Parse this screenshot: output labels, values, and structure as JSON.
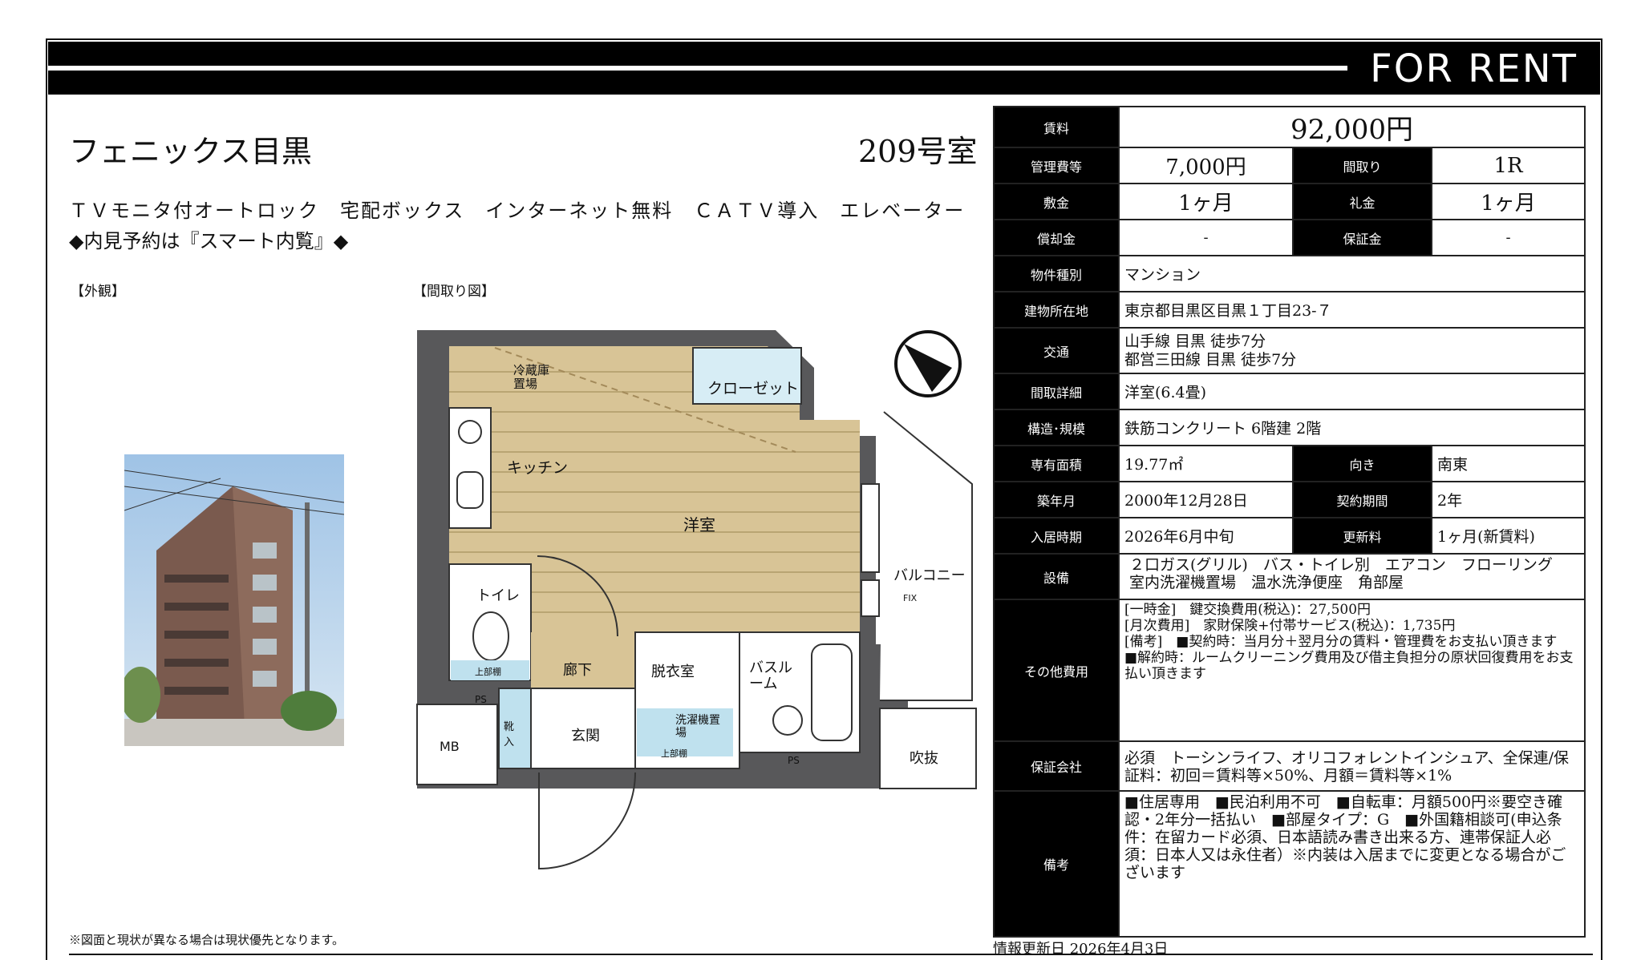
{
  "banner": {
    "title": "FOR RENT"
  },
  "property": {
    "name": "フェニックス目黒",
    "room": "209号室",
    "features": "ＴＶモニタ付オートロック　宅配ボックス　インターネット無料　ＣＡＴＶ導入　エレベーター",
    "viewing": "◆内見予約は『スマート内覧』◆"
  },
  "labels": {
    "exterior": "【外観】",
    "floorplan": "【間取り図】"
  },
  "floorplan": {
    "fridge": "冷蔵庫置場",
    "closet": "クローゼット",
    "kitchen": "キッチン",
    "western_room": "洋室",
    "toilet": "トイレ",
    "balcony": "バルコニー",
    "corridor": "廊下",
    "dressing": "脱衣室",
    "bath": "バスルーム",
    "entrance": "玄関",
    "laundry": "洗濯機置場",
    "void": "吹抜",
    "mb": "MB",
    "ps": "PS",
    "ps2": "PS",
    "shoes": "靴入",
    "upper": "上部棚",
    "upper2": "上部棚",
    "fix": "FIX"
  },
  "spec": {
    "rent_label": "賃料",
    "rent": "92,000円",
    "mgmt_label": "管理費等",
    "mgmt": "7,000円",
    "layout_label": "間取り",
    "layout": "1R",
    "deposit_label": "敷金",
    "deposit": "1ヶ月",
    "keymoney_label": "礼金",
    "keymoney": "1ヶ月",
    "amort_label": "償却金",
    "amort": "-",
    "guarantee_label": "保証金",
    "guarantee": "-",
    "type_label": "物件種別",
    "type": "マンション",
    "address_label": "建物所在地",
    "address": "東京都目黒区目黒１丁目23-７",
    "transport_label": "交通",
    "transport1": "山手線 目黒 徒歩7分",
    "transport2": "都営三田線 目黒 徒歩7分",
    "detail_label": "間取詳細",
    "detail": "洋室(6.4畳)",
    "structure_label": "構造･規模",
    "structure": "鉄筋コンクリート 6階建 2階",
    "area_label": "専有面積",
    "area": "19.77㎡",
    "direction_label": "向き",
    "direction": "南東",
    "built_label": "築年月",
    "built": "2000年12月28日",
    "term_label": "契約期間",
    "term": "2年",
    "movein_label": "入居時期",
    "movein": "2026年6月中旬",
    "renewal_label": "更新料",
    "renewal": "1ヶ月(新賃料)",
    "equip_label": "設備",
    "equip": "２口ガス(グリル)　バス・トイレ別　エアコン　フローリング　室内洗濯機置場　温水洗浄便座　角部屋",
    "other_label": "その他費用",
    "other1": "[一時金]　鍵交換費用(税込)：27,500円",
    "other2": "[月次費用]　家財保険+付帯サービス(税込)：1,735円",
    "other3": "[備考]　■契約時：当月分＋翌月分の賃料・管理費をお支払い頂きます　■解約時：ルームクリーニング費用及び借主負担分の原状回復費用をお支払い頂きます",
    "company_label": "保証会社",
    "company": "必須　トーシンライフ、オリコフォレントインシュア、全保連/保証料：初回＝賃料等×50%、月額＝賃料等×1%",
    "remarks_label": "備考",
    "remarks": "■住居専用　■民泊利用不可　■自転車：月額500円※要空き確認・2年分一括払い　■部屋タイプ：G　■外国籍相談可(申込条件：在留カード必須、日本語読み書き出来る方、連帯保証人必須：日本人又は永住者）※内装は入居までに変更となる場合がございます"
  },
  "footer": {
    "note": "※図面と現状が異なる場合は現状優先となります。",
    "updated": "情報更新日 2026年4月3日"
  }
}
